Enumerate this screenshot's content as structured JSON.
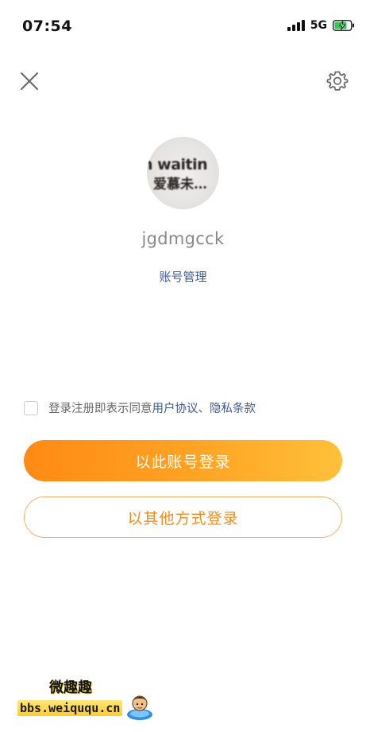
{
  "status_bar": {
    "time": "07:54",
    "network": "5G",
    "battery_state": "charging"
  },
  "nav": {
    "close_icon": "close-icon",
    "settings_icon": "gear-icon"
  },
  "avatar": {
    "text_line1": "n waitin",
    "text_line2": "爱慕未…"
  },
  "profile": {
    "username": "jgdmgcck",
    "account_manage_label": "账号管理"
  },
  "agreement": {
    "prefix": "登录注册即表示同意",
    "user_agreement": "用户协议",
    "separator": "、",
    "privacy_policy": "隐私条款"
  },
  "buttons": {
    "login_this_account": "以此账号登录",
    "login_other_method": "以其他方式登录"
  },
  "watermark": {
    "title": "微趣趣",
    "url": "bbs.weiququ.cn"
  },
  "colors": {
    "accent_orange": "#ff9a1f",
    "link_blue": "#3d5a8f",
    "battery_green": "#34c759"
  }
}
